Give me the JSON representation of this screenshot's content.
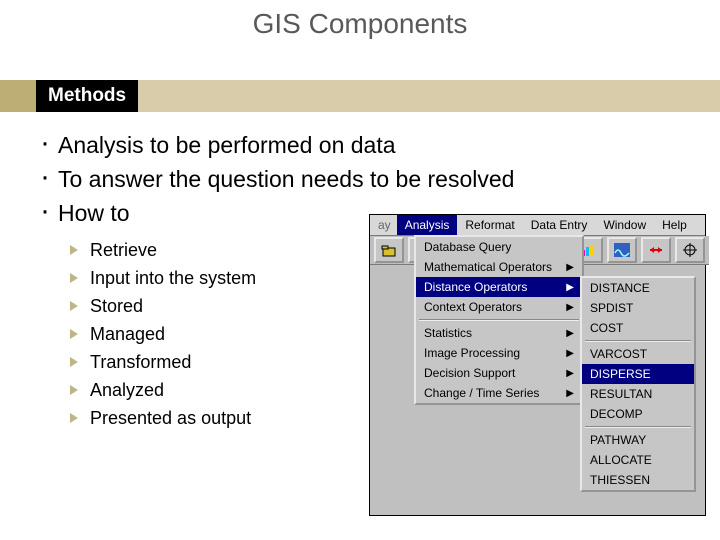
{
  "title": "GIS Components",
  "section_label": "Methods",
  "bullets": [
    "Analysis to be performed on data",
    "To answer the question needs to be resolved",
    "How to"
  ],
  "sub_bullets": [
    "Retrieve",
    "Input into the system",
    "Stored",
    "Managed",
    "Transformed",
    "Analyzed",
    "Presented as output"
  ],
  "app": {
    "menu": {
      "cut": "ay",
      "analysis": "Analysis",
      "reformat": "Reformat",
      "dataentry": "Data Entry",
      "window": "Window",
      "help": "Help"
    },
    "dropdown1": {
      "dbquery": "Database Query",
      "mathops": "Mathematical Operators",
      "distops": "Distance Operators",
      "ctxops": "Context Operators",
      "stats": "Statistics",
      "imgproc": "Image Processing",
      "decision": "Decision Support",
      "timeseries": "Change / Time Series"
    },
    "dropdown2": {
      "distance": "DISTANCE",
      "spdist": "SPDIST",
      "cost": "COST",
      "varcost": "VARCOST",
      "disperse": "DISPERSE",
      "resultan": "RESULTAN",
      "decomp": "DECOMP",
      "pathway": "PATHWAY",
      "allocate": "ALLOCATE",
      "thiessen": "THIESSEN"
    }
  }
}
